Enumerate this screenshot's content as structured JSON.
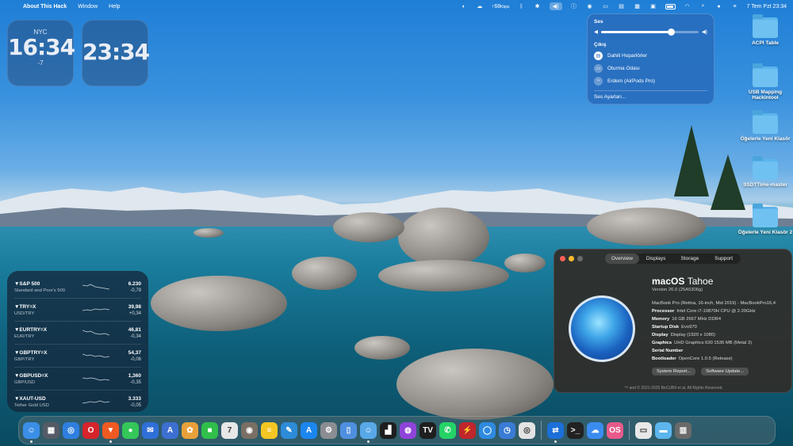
{
  "menubar": {
    "apple_glyph": "",
    "items": [
      "About This Hack",
      "Window",
      "Help"
    ],
    "network": "↑68",
    "network_unit": "Kbps",
    "clock": "7 Tem Pzt  23:34"
  },
  "clocks": [
    {
      "city": "NYC",
      "time": "16:34",
      "offset": "-7"
    },
    {
      "city": "",
      "time": "23:34",
      "offset": ""
    }
  ],
  "sound_panel": {
    "title": "Ses",
    "volume_percent": 72,
    "output_title": "Çıkış",
    "devices": [
      {
        "name": "Dahili Hoparlörler",
        "icon": "speaker-icon",
        "active": true
      },
      {
        "name": "Oturma Odası",
        "icon": "tv-icon",
        "active": false
      },
      {
        "name": "Erdem (AirPods Pro)",
        "icon": "airpods-icon",
        "active": false
      }
    ],
    "settings_link": "Ses Ayarları..."
  },
  "desktop_icons": [
    {
      "label": "ACPI Table"
    },
    {
      "label": "USB Mapping Hackintool"
    },
    {
      "label": "Öğelerle Yeni Klasör"
    },
    {
      "label": "SSDTTime-master"
    },
    {
      "label": "Öğelerle Yeni Klasör 2"
    }
  ],
  "stocks": [
    {
      "symbol": "▼S&P 500",
      "name": "Standard and Poor's 500",
      "price": "6.230",
      "change": "-0,79"
    },
    {
      "symbol": "▼TRY=X",
      "name": "USD/TRY",
      "price": "39,98",
      "change": "+0,34"
    },
    {
      "symbol": "▼EURTRY=X",
      "name": "EUR/TRY",
      "price": "46,81",
      "change": "-0,34"
    },
    {
      "symbol": "▼GBPTRY=X",
      "name": "GBP/TRY",
      "price": "54,37",
      "change": "-0,06"
    },
    {
      "symbol": "▼GBPUSD=X",
      "name": "GBP/USD",
      "price": "1,360",
      "change": "-0,35"
    },
    {
      "symbol": "▼XAUT-USD",
      "name": "Tether Gold USD",
      "price": "3.333",
      "change": "-0,05"
    }
  ],
  "about": {
    "tabs": [
      "Overview",
      "Displays",
      "Storage",
      "Support"
    ],
    "os_name": "macOS",
    "os_release": "Tahoe",
    "version": "Version 26.0 (25A5306g)",
    "specs": [
      {
        "k": "",
        "v": "MacBook Pro (Retina, 16-inch, Mid 2019) - MacBookPro16,4"
      },
      {
        "k": "Processor",
        "v": "Intel Core i7-10870H CPU @ 2.20GHz"
      },
      {
        "k": "Memory",
        "v": "16 GB 2667 MHz DDR4"
      },
      {
        "k": "Startup Disk",
        "v": "Evo970"
      },
      {
        "k": "Display",
        "v": "Display (1920 x 1080)"
      },
      {
        "k": "Graphics",
        "v": "UHD Graphics 630 1536 MB (Metal 3)"
      },
      {
        "k": "Serial Number",
        "v": ""
      },
      {
        "k": "Bootloader",
        "v": "OpenCore 1.0.5 (Release)"
      }
    ],
    "buttons": [
      "System Report...",
      "Software Update..."
    ],
    "copyright": "™ and © 2021-2025 BeCUBII et al. All Rights Reserved."
  },
  "dock": {
    "apps": [
      {
        "name": "finder",
        "color": "#3a8ee6",
        "glyph": "☺",
        "running": true
      },
      {
        "name": "launchpad",
        "color": "#555b66",
        "glyph": "▦",
        "running": false
      },
      {
        "name": "safari",
        "color": "#2f7fe0",
        "glyph": "◎",
        "running": false
      },
      {
        "name": "opera",
        "color": "#d7242c",
        "glyph": "O",
        "running": false
      },
      {
        "name": "brave",
        "color": "#f05a22",
        "glyph": "▼",
        "running": true
      },
      {
        "name": "messages",
        "color": "#34c759",
        "glyph": "●",
        "running": false
      },
      {
        "name": "mail",
        "color": "#2f6fd8",
        "glyph": "✉",
        "running": false
      },
      {
        "name": "altstore",
        "color": "#3d6fd1",
        "glyph": "A",
        "running": false
      },
      {
        "name": "photos",
        "color": "#e8a13a",
        "glyph": "✿",
        "running": false
      },
      {
        "name": "facetime",
        "color": "#2fbf4a",
        "glyph": "■",
        "running": false
      },
      {
        "name": "calendar",
        "color": "#e7e7e7",
        "glyph": "7",
        "running": false
      },
      {
        "name": "contacts",
        "color": "#7a6f63",
        "glyph": "◉",
        "running": false
      },
      {
        "name": "notes",
        "color": "#f3c623",
        "glyph": "≡",
        "running": false
      },
      {
        "name": "freeform",
        "color": "#2d8bd8",
        "glyph": "✎",
        "running": false
      },
      {
        "name": "app-store",
        "color": "#1c86f0",
        "glyph": "A",
        "running": false
      },
      {
        "name": "system-settings",
        "color": "#8a8d92",
        "glyph": "⚙",
        "running": false
      },
      {
        "name": "preview",
        "color": "#4f8fe0",
        "glyph": "▯",
        "running": false
      },
      {
        "name": "finder-2",
        "color": "#58a8e8",
        "glyph": "☺",
        "running": true
      },
      {
        "name": "activity-monitor",
        "color": "#1e1e1e",
        "glyph": "▟",
        "running": false
      },
      {
        "name": "podcasts",
        "color": "#8e44d8",
        "glyph": "◍",
        "running": false
      },
      {
        "name": "tradingview",
        "color": "#1f1f1f",
        "glyph": "TV",
        "running": false
      },
      {
        "name": "whatsapp",
        "color": "#25d366",
        "glyph": "✆",
        "running": false
      },
      {
        "name": "utility",
        "color": "#c0262c",
        "glyph": "⚡",
        "running": false
      },
      {
        "name": "xcode",
        "color": "#2f8ae0",
        "glyph": "◯",
        "running": false
      },
      {
        "name": "clock-app",
        "color": "#3a7bd5",
        "glyph": "◷",
        "running": false
      },
      {
        "name": "disk-utility",
        "color": "#e3e3e3",
        "glyph": "◎",
        "running": false
      }
    ],
    "apps_right": [
      {
        "name": "tool-a",
        "color": "#1b6fd8",
        "glyph": "⇄",
        "running": true
      },
      {
        "name": "terminal",
        "color": "#222222",
        "glyph": ">_",
        "running": false
      },
      {
        "name": "tool-b",
        "color": "#3b8cf0",
        "glyph": "☁",
        "running": false
      },
      {
        "name": "opencore",
        "color": "#e85a8a",
        "glyph": "OS",
        "running": false
      }
    ],
    "trash_items": [
      {
        "name": "document",
        "color": "#e8e8e8",
        "glyph": "▭"
      },
      {
        "name": "folder",
        "color": "#5cb5ec",
        "glyph": "▬"
      },
      {
        "name": "trash",
        "color": "#6a6a6a",
        "glyph": "▥"
      }
    ]
  }
}
